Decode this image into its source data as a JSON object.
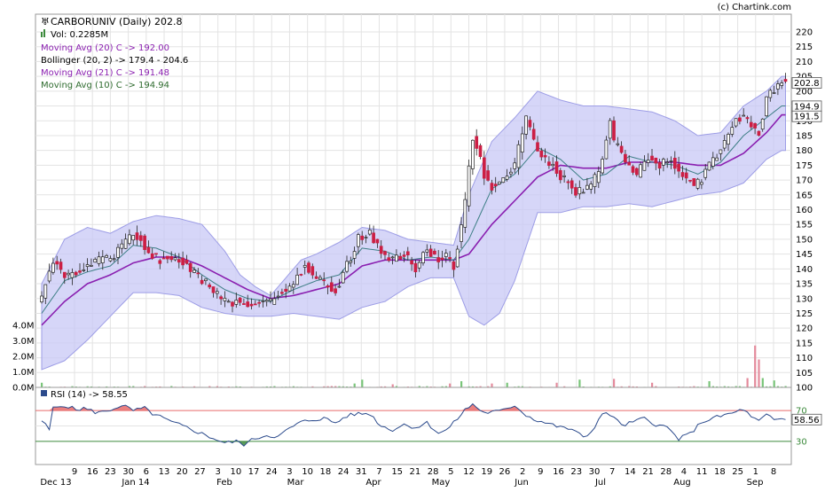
{
  "credit": "(c) Chartink.com",
  "colors": {
    "bull": "#ffffff",
    "bear": "#cc1f44",
    "wick": "#222222",
    "band_fill": "#c8c8f6",
    "band_line": "#9d9de6",
    "ma_purple": "#8a1fb0",
    "ma_teal": "#3e7f86",
    "volume": "#79c579",
    "rsi_line": "#2b4a8c",
    "rsi_over": "#e86a6a",
    "rsi_under": "#3c8a3c",
    "grid": "#e3e3e3"
  },
  "legend": {
    "title": "CARBORUNIV (Daily) 202.8",
    "vol": "Vol: 0.2285M",
    "ma20": "Moving Avg (20) C -> 192.00",
    "bb": "Bollinger (20, 2) -> 179.4 - 204.6",
    "ma21": "Moving Avg (21) C -> 191.48",
    "ma10": "Moving Avg (10) C -> 194.94"
  },
  "rsi_legend": "RSI (14) -> 58.55",
  "chart_data": {
    "type": "candlestick",
    "price_axis": {
      "min": 100,
      "max": 220,
      "step": 5,
      "ticks": [
        "100",
        "105",
        "110",
        "115",
        "120",
        "125",
        "130",
        "135",
        "140",
        "145",
        "150",
        "155",
        "160",
        "165",
        "170",
        "175",
        "180",
        "185",
        "190",
        "195",
        "200",
        "205",
        "210",
        "215",
        "220"
      ]
    },
    "price_labels": [
      {
        "text": "202.8",
        "value": 202.8
      },
      {
        "text": "194.9",
        "value": 194.9
      },
      {
        "text": "191.5",
        "value": 191.5
      }
    ],
    "volume_axis": {
      "min": 0,
      "max": 4.0,
      "ticks": [
        "0.0M",
        "1.0M",
        "2.0M",
        "3.0M",
        "4.0M"
      ]
    },
    "rsi_axis": {
      "min": 0,
      "max": 100,
      "overbought": 70,
      "oversold": 30,
      "ticks": [
        "70",
        "30"
      ],
      "last_label": "58.56"
    },
    "x_day_labels": [
      "9",
      "16",
      "23",
      "30",
      "6",
      "13",
      "20",
      "27",
      "3",
      "10",
      "17",
      "24",
      "3",
      "10",
      "18",
      "24",
      "31",
      "7",
      "15",
      "21",
      "28",
      "5",
      "12",
      "19",
      "26",
      "2",
      "9",
      "16",
      "23",
      "30",
      "7",
      "14",
      "21",
      "28",
      "4",
      "11",
      "18",
      "25",
      "1",
      "8"
    ],
    "x_month_labels": [
      "Dec 13",
      "Jan 14",
      "Feb",
      "Mar",
      "Apr",
      "May",
      "Jun",
      "Jul",
      "Aug",
      "Sep"
    ],
    "close_anchors": [
      [
        0,
        131
      ],
      [
        3,
        143
      ],
      [
        7,
        137
      ],
      [
        11,
        140
      ],
      [
        15,
        143
      ],
      [
        18,
        144
      ],
      [
        21,
        147
      ],
      [
        24,
        152
      ],
      [
        26,
        150
      ],
      [
        28,
        146
      ],
      [
        31,
        143
      ],
      [
        34,
        144
      ],
      [
        37,
        142
      ],
      [
        40,
        138
      ],
      [
        43,
        135
      ],
      [
        46,
        131
      ],
      [
        49,
        129
      ],
      [
        53,
        129
      ],
      [
        56,
        128
      ],
      [
        60,
        129
      ],
      [
        63,
        132
      ],
      [
        66,
        136
      ],
      [
        69,
        141
      ],
      [
        72,
        137
      ],
      [
        74,
        135
      ],
      [
        77,
        133
      ],
      [
        80,
        141
      ],
      [
        83,
        150
      ],
      [
        86,
        152
      ],
      [
        89,
        146
      ],
      [
        92,
        143
      ],
      [
        95,
        145
      ],
      [
        98,
        140
      ],
      [
        101,
        147
      ],
      [
        104,
        143
      ],
      [
        106,
        144
      ],
      [
        108,
        141
      ],
      [
        111,
        162
      ],
      [
        113,
        185
      ],
      [
        116,
        172
      ],
      [
        118,
        168
      ],
      [
        121,
        170
      ],
      [
        124,
        175
      ],
      [
        127,
        191
      ],
      [
        129,
        183
      ],
      [
        131,
        178
      ],
      [
        134,
        175
      ],
      [
        137,
        170
      ],
      [
        140,
        166
      ],
      [
        143,
        167
      ],
      [
        146,
        172
      ],
      [
        149,
        190
      ],
      [
        150,
        183
      ],
      [
        153,
        176
      ],
      [
        156,
        172
      ],
      [
        159,
        178
      ],
      [
        162,
        175
      ],
      [
        165,
        177
      ],
      [
        168,
        172
      ],
      [
        171,
        168
      ],
      [
        173,
        170
      ],
      [
        176,
        177
      ],
      [
        179,
        183
      ],
      [
        182,
        190
      ],
      [
        184,
        192
      ],
      [
        186,
        188
      ],
      [
        188,
        186
      ],
      [
        190,
        197
      ],
      [
        192,
        201
      ],
      [
        194,
        203
      ]
    ],
    "ma10_anchors": [
      [
        0,
        125
      ],
      [
        6,
        136
      ],
      [
        12,
        139
      ],
      [
        18,
        141
      ],
      [
        24,
        148
      ],
      [
        30,
        147
      ],
      [
        36,
        144
      ],
      [
        42,
        138
      ],
      [
        48,
        133
      ],
      [
        54,
        130
      ],
      [
        60,
        129
      ],
      [
        66,
        133
      ],
      [
        72,
        136
      ],
      [
        78,
        138
      ],
      [
        84,
        147
      ],
      [
        90,
        146
      ],
      [
        96,
        143
      ],
      [
        102,
        144
      ],
      [
        108,
        143
      ],
      [
        112,
        150
      ],
      [
        118,
        167
      ],
      [
        124,
        172
      ],
      [
        130,
        181
      ],
      [
        136,
        177
      ],
      [
        142,
        170
      ],
      [
        148,
        172
      ],
      [
        154,
        178
      ],
      [
        160,
        176
      ],
      [
        166,
        175
      ],
      [
        172,
        172
      ],
      [
        178,
        176
      ],
      [
        184,
        185
      ],
      [
        190,
        191
      ],
      [
        194,
        195
      ]
    ],
    "ma20_anchors": [
      [
        0,
        121
      ],
      [
        6,
        129
      ],
      [
        12,
        135
      ],
      [
        18,
        138
      ],
      [
        24,
        142
      ],
      [
        30,
        144
      ],
      [
        36,
        144
      ],
      [
        42,
        141
      ],
      [
        48,
        137
      ],
      [
        54,
        133
      ],
      [
        60,
        130
      ],
      [
        66,
        131
      ],
      [
        72,
        133
      ],
      [
        78,
        135
      ],
      [
        84,
        141
      ],
      [
        90,
        143
      ],
      [
        96,
        143
      ],
      [
        102,
        143
      ],
      [
        108,
        143
      ],
      [
        112,
        145
      ],
      [
        118,
        155
      ],
      [
        124,
        163
      ],
      [
        130,
        171
      ],
      [
        136,
        175
      ],
      [
        142,
        174
      ],
      [
        148,
        174
      ],
      [
        154,
        176
      ],
      [
        160,
        176
      ],
      [
        166,
        176
      ],
      [
        172,
        175
      ],
      [
        178,
        175
      ],
      [
        184,
        179
      ],
      [
        190,
        186
      ],
      [
        194,
        192
      ]
    ],
    "bb_upper_anchors": [
      [
        0,
        135
      ],
      [
        6,
        150
      ],
      [
        12,
        154
      ],
      [
        18,
        152
      ],
      [
        24,
        156
      ],
      [
        30,
        158
      ],
      [
        36,
        157
      ],
      [
        42,
        155
      ],
      [
        48,
        146
      ],
      [
        52,
        138
      ],
      [
        56,
        134
      ],
      [
        60,
        131
      ],
      [
        64,
        137
      ],
      [
        68,
        143
      ],
      [
        72,
        145
      ],
      [
        78,
        149
      ],
      [
        84,
        154
      ],
      [
        90,
        153
      ],
      [
        96,
        150
      ],
      [
        102,
        149
      ],
      [
        108,
        148
      ],
      [
        112,
        165
      ],
      [
        118,
        183
      ],
      [
        124,
        191
      ],
      [
        130,
        200
      ],
      [
        136,
        197
      ],
      [
        142,
        195
      ],
      [
        148,
        195
      ],
      [
        154,
        194
      ],
      [
        160,
        193
      ],
      [
        166,
        190
      ],
      [
        172,
        185
      ],
      [
        178,
        186
      ],
      [
        184,
        195
      ],
      [
        190,
        200
      ],
      [
        194,
        205
      ]
    ],
    "bb_lower_anchors": [
      [
        0,
        106
      ],
      [
        6,
        109
      ],
      [
        12,
        116
      ],
      [
        18,
        124
      ],
      [
        24,
        132
      ],
      [
        30,
        132
      ],
      [
        36,
        131
      ],
      [
        42,
        127
      ],
      [
        48,
        125
      ],
      [
        54,
        124
      ],
      [
        60,
        124
      ],
      [
        66,
        125
      ],
      [
        72,
        124
      ],
      [
        78,
        123
      ],
      [
        84,
        127
      ],
      [
        90,
        129
      ],
      [
        96,
        134
      ],
      [
        102,
        137
      ],
      [
        108,
        137
      ],
      [
        112,
        124
      ],
      [
        116,
        121
      ],
      [
        120,
        125
      ],
      [
        124,
        136
      ],
      [
        130,
        159
      ],
      [
        136,
        159
      ],
      [
        142,
        161
      ],
      [
        148,
        161
      ],
      [
        154,
        162
      ],
      [
        160,
        161
      ],
      [
        166,
        163
      ],
      [
        172,
        165
      ],
      [
        178,
        166
      ],
      [
        184,
        169
      ],
      [
        190,
        177
      ],
      [
        194,
        180
      ]
    ],
    "volume_spikes": [
      [
        0,
        0.3
      ],
      [
        82,
        0.25
      ],
      [
        84,
        0.5
      ],
      [
        92,
        0.2
      ],
      [
        107,
        0.25
      ],
      [
        110,
        0.4
      ],
      [
        118,
        0.25
      ],
      [
        122,
        0.3
      ],
      [
        135,
        0.3
      ],
      [
        141,
        0.5
      ],
      [
        150,
        0.55
      ],
      [
        160,
        0.3
      ],
      [
        175,
        0.4
      ],
      [
        185,
        0.6
      ],
      [
        187,
        2.7
      ],
      [
        188,
        1.8
      ],
      [
        189,
        0.6
      ],
      [
        192,
        0.45
      ]
    ],
    "rsi_anchors": [
      [
        0,
        57
      ],
      [
        2,
        45
      ],
      [
        3,
        73
      ],
      [
        6,
        77
      ],
      [
        9,
        71
      ],
      [
        11,
        73
      ],
      [
        14,
        68
      ],
      [
        16,
        68
      ],
      [
        18,
        71
      ],
      [
        20,
        75
      ],
      [
        22,
        75
      ],
      [
        24,
        70
      ],
      [
        27,
        73
      ],
      [
        29,
        66
      ],
      [
        31,
        62
      ],
      [
        34,
        55
      ],
      [
        37,
        50
      ],
      [
        40,
        44
      ],
      [
        43,
        38
      ],
      [
        46,
        32
      ],
      [
        48,
        28
      ],
      [
        51,
        30
      ],
      [
        53,
        26
      ],
      [
        56,
        34
      ],
      [
        59,
        38
      ],
      [
        62,
        36
      ],
      [
        65,
        47
      ],
      [
        68,
        55
      ],
      [
        71,
        58
      ],
      [
        74,
        60
      ],
      [
        77,
        54
      ],
      [
        80,
        63
      ],
      [
        83,
        66
      ],
      [
        86,
        66
      ],
      [
        89,
        50
      ],
      [
        92,
        45
      ],
      [
        95,
        52
      ],
      [
        98,
        48
      ],
      [
        101,
        54
      ],
      [
        104,
        41
      ],
      [
        106,
        44
      ],
      [
        108,
        54
      ],
      [
        111,
        71
      ],
      [
        113,
        78
      ],
      [
        116,
        67
      ],
      [
        118,
        68
      ],
      [
        121,
        70
      ],
      [
        124,
        77
      ],
      [
        127,
        64
      ],
      [
        130,
        57
      ],
      [
        133,
        53
      ],
      [
        136,
        48
      ],
      [
        139,
        46
      ],
      [
        142,
        35
      ],
      [
        144,
        42
      ],
      [
        147,
        66
      ],
      [
        150,
        63
      ],
      [
        152,
        50
      ],
      [
        155,
        55
      ],
      [
        158,
        60
      ],
      [
        161,
        52
      ],
      [
        164,
        48
      ],
      [
        167,
        33
      ],
      [
        170,
        40
      ],
      [
        173,
        55
      ],
      [
        176,
        60
      ],
      [
        179,
        64
      ],
      [
        182,
        68
      ],
      [
        184,
        72
      ],
      [
        186,
        61
      ],
      [
        188,
        56
      ],
      [
        190,
        64
      ],
      [
        192,
        58
      ],
      [
        194,
        59
      ]
    ]
  }
}
